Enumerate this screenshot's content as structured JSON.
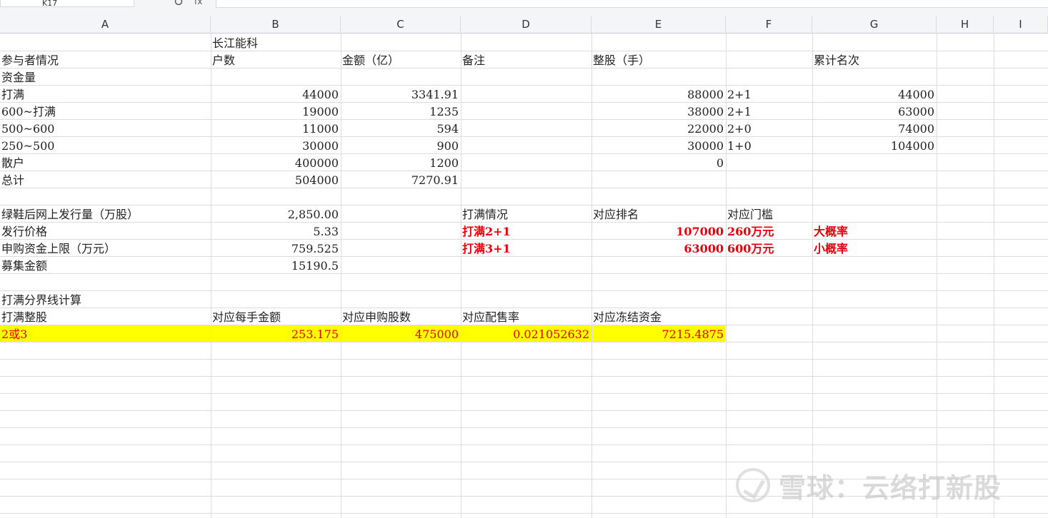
{
  "formula_bar": {
    "name_box": "K17",
    "fx_label": "fx"
  },
  "columns": [
    "A",
    "B",
    "C",
    "D",
    "E",
    "F",
    "G",
    "H",
    "I"
  ],
  "cells": {
    "r1": {
      "B": "长江能科"
    },
    "r2": {
      "A": "参与者情况",
      "B": "户数",
      "C": "金额（亿）",
      "D": "备注",
      "E": "整股（手）",
      "G": "累计名次"
    },
    "r3": {
      "A": "资金量"
    },
    "r4": {
      "A": "打满",
      "B": "44000",
      "C": "3341.91",
      "E": "88000",
      "F": "2+1",
      "G": "44000"
    },
    "r5": {
      "A": "600~打满",
      "B": "19000",
      "C": "1235",
      "E": "38000",
      "F": "2+1",
      "G": "63000"
    },
    "r6": {
      "A": "500~600",
      "B": "11000",
      "C": "594",
      "E": "22000",
      "F": "2+0",
      "G": "74000"
    },
    "r7": {
      "A": "250~500",
      "B": "30000",
      "C": "900",
      "E": "30000",
      "F": "1+0",
      "G": "104000"
    },
    "r8": {
      "A": "散户",
      "B": "400000",
      "C": "1200",
      "E": "0"
    },
    "r9": {
      "A": "总计",
      "B": "504000",
      "C": "7270.91"
    },
    "r11": {
      "A": "绿鞋后网上发行量（万股）",
      "B": "2,850.00",
      "D": "打满情况",
      "E": "对应排名",
      "F": "对应门槛"
    },
    "r12": {
      "A": "发行价格",
      "B": "5.33",
      "D": "打满2+1",
      "E": "107000",
      "F": "260万元",
      "G": "大概率"
    },
    "r13": {
      "A": "申购资金上限（万元）",
      "B": "759.525",
      "D": "打满3+1",
      "E": "63000",
      "F": "600万元",
      "G": "小概率"
    },
    "r14": {
      "A": "募集金额",
      "B": "15190.5"
    },
    "r16": {
      "A": "打满分界线计算"
    },
    "r17": {
      "A": "打满整股",
      "B": "对应每手金额",
      "C": "对应申购股数",
      "D": "对应配售率",
      "E": "对应冻结资金"
    },
    "r18": {
      "A": "2或3",
      "B": "253.175",
      "C": "475000",
      "D": "0.021052632",
      "E": "7215.4875"
    }
  },
  "colors": {
    "red": "#e8000b",
    "highlight": "#ffff00"
  },
  "watermark": {
    "icon": "xueqiu-logo-icon",
    "text": "雪球：云络打新股"
  }
}
